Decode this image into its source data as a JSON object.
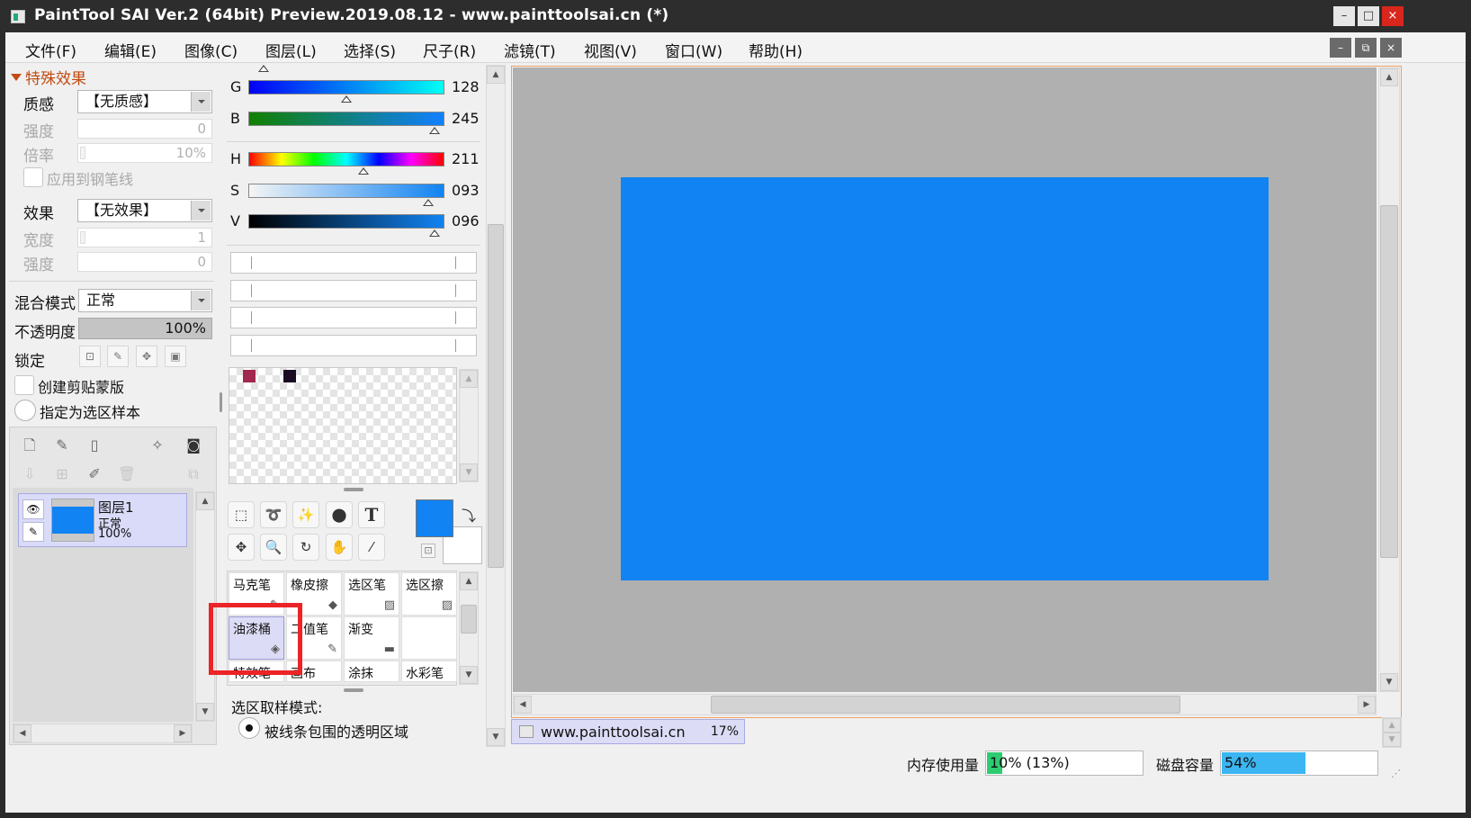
{
  "window": {
    "title": "PaintTool SAI Ver.2 (64bit) Preview.2019.08.12 - www.painttoolsai.cn (*)",
    "min": "–",
    "max": "□",
    "close": "×"
  },
  "menu": [
    "文件(F)",
    "编辑(E)",
    "图像(C)",
    "图层(L)",
    "选择(S)",
    "尺子(R)",
    "滤镜(T)",
    "视图(V)",
    "窗口(W)",
    "帮助(H)"
  ],
  "mdi": {
    "min": "–",
    "restore": "⧉",
    "close": "×"
  },
  "left_panel": {
    "section_title": "特殊效果",
    "texture_label": "质感",
    "texture_value": "【无质感】",
    "strength_label": "强度",
    "strength_value": "0",
    "ratio_label": "倍率",
    "ratio_value": "10%",
    "apply_pen_label": "应用到钢笔线",
    "effect_label": "效果",
    "effect_value": "【无效果】",
    "width_label": "宽度",
    "width_value": "1",
    "strength2_label": "强度",
    "strength2_value": "0",
    "blend_label": "混合模式",
    "blend_value": "正常",
    "opacity_label": "不透明度",
    "opacity_value": "100%",
    "lock_label": "锁定",
    "clip_mask_label": "创建剪贴蒙版",
    "sample_label": "指定为选区样本"
  },
  "layer": {
    "name": "图层1",
    "mode": "正常",
    "opacity": "100%"
  },
  "color_sliders": {
    "g_label": "G",
    "g_value": "128",
    "b_label": "B",
    "b_value": "245",
    "h_label": "H",
    "h_value": "211",
    "s_label": "S",
    "s_value": "093",
    "v_label": "V",
    "v_value": "096"
  },
  "colors": {
    "primary": "#1183f2",
    "secondary": "#ffffff",
    "swatch1": "#a3284f",
    "swatch2": "#1a0a24"
  },
  "tools": {
    "text_tool": "T"
  },
  "brushes": [
    {
      "label": "马克笔",
      "icon": "✎"
    },
    {
      "label": "橡皮擦",
      "icon": "◆"
    },
    {
      "label": "选区笔",
      "icon": "▨"
    },
    {
      "label": "选区擦",
      "icon": "▨"
    },
    {
      "label": "油漆桶",
      "icon": "◈"
    },
    {
      "label": "二值笔",
      "icon": "✎"
    },
    {
      "label": "渐变",
      "icon": "▬"
    },
    {
      "label": "",
      "icon": ""
    },
    {
      "label": "特效笔",
      "icon": ""
    },
    {
      "label": "画布",
      "icon": ""
    },
    {
      "label": "涂抹",
      "icon": ""
    },
    {
      "label": "水彩笔",
      "icon": ""
    }
  ],
  "tool_options": {
    "sample_mode_label": "选区取样模式:",
    "sample_mode_value": "被线条包围的透明区域"
  },
  "document_tab": {
    "name": "www.painttoolsai.cn",
    "zoom": "17%"
  },
  "status": {
    "memory_label": "内存使用量",
    "memory_value": "10% (13%)",
    "memory_fraction": 0.1,
    "disk_label": "磁盘容量",
    "disk_value": "54%",
    "disk_fraction": 0.54
  }
}
